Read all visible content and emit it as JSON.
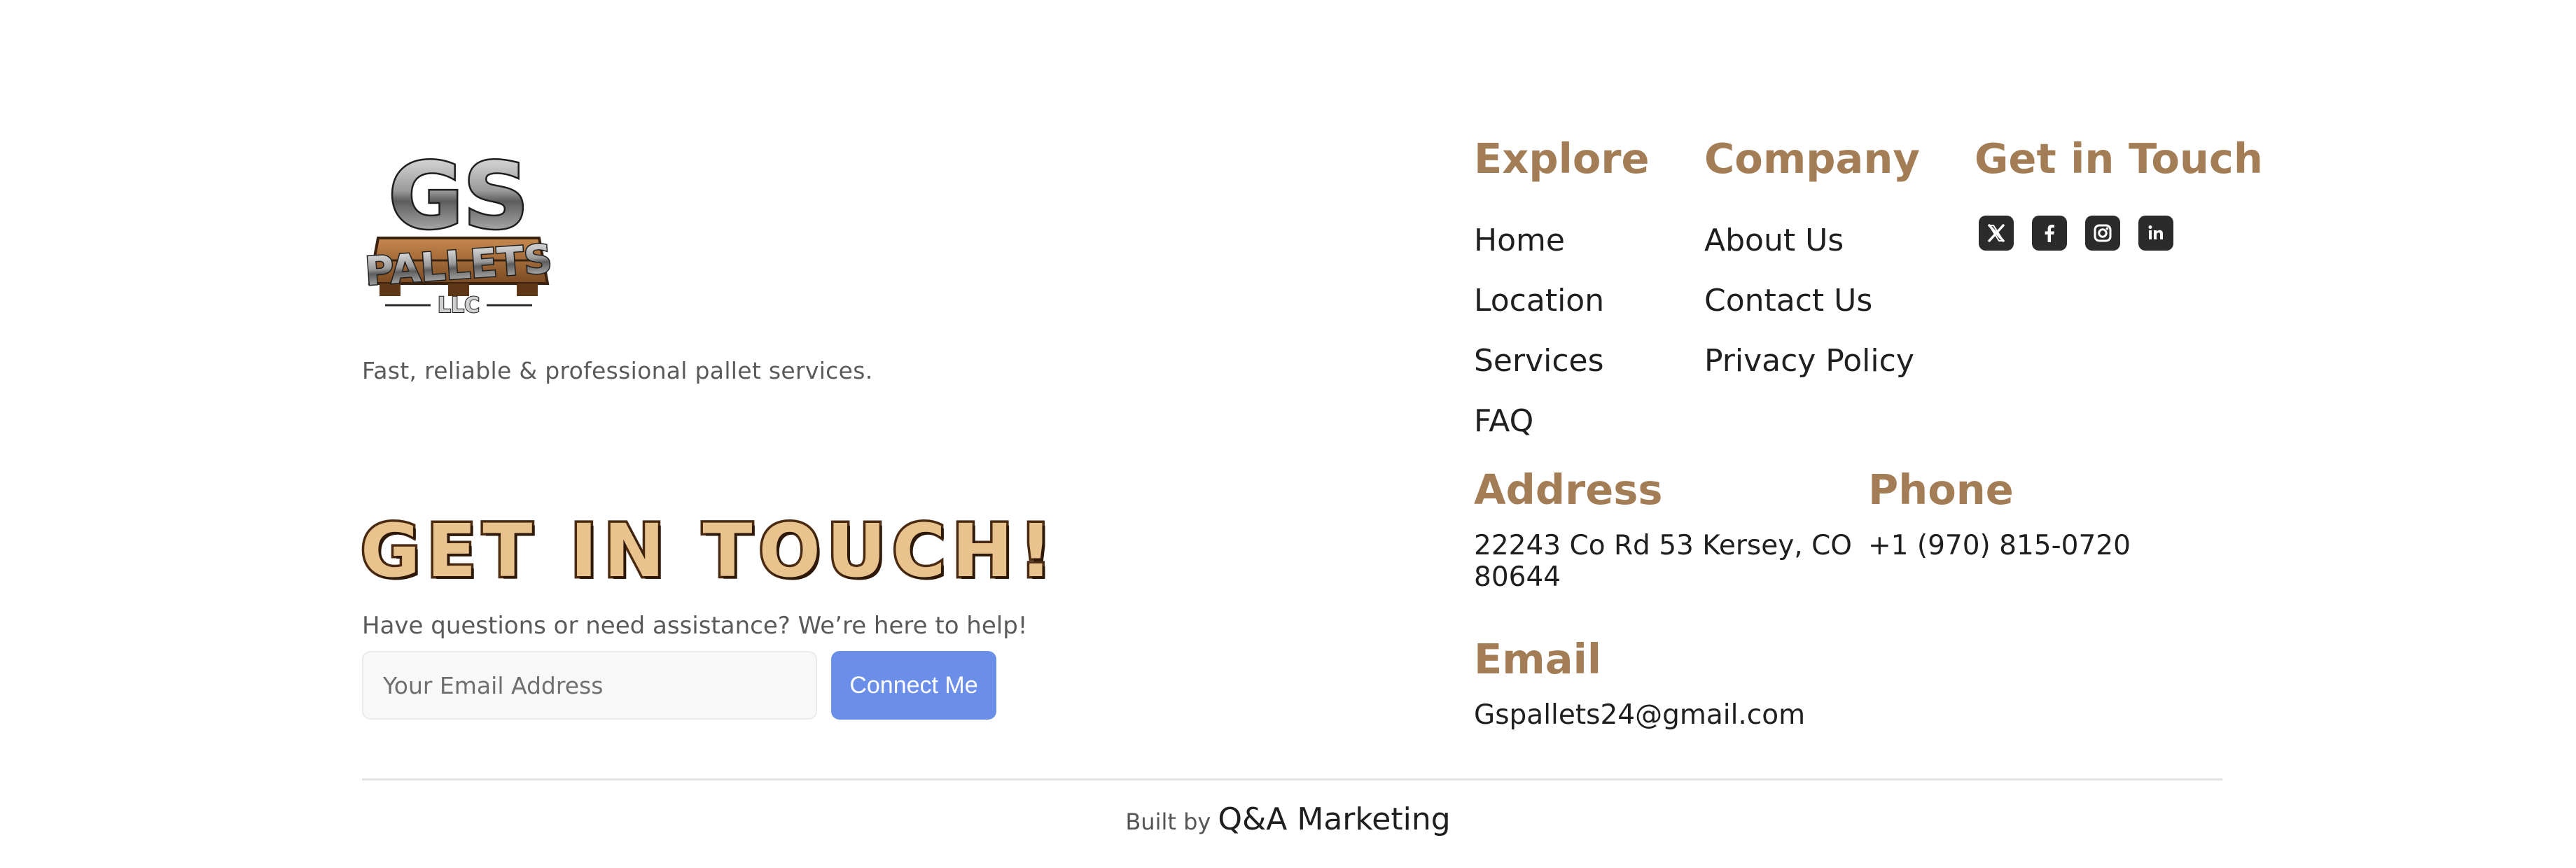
{
  "brand": {
    "logo_text_top": "GS",
    "logo_text_mid": "PALLETS",
    "logo_text_bottom": "LLC",
    "tagline": "Fast, reliable & professional pallet services."
  },
  "contact_form": {
    "title": "GET IN TOUCH!",
    "subtitle": "Have questions or need assistance? We’re here to help!",
    "email_placeholder": "Your Email Address",
    "button_label": "Connect Me"
  },
  "explore": {
    "heading": "Explore",
    "links": [
      "Home",
      "Location",
      "Services",
      "FAQ"
    ]
  },
  "company": {
    "heading": "Company",
    "links": [
      "About Us",
      "Contact Us",
      "Privacy Policy"
    ]
  },
  "social": {
    "heading": "Get in Touch",
    "icons": [
      "x-icon",
      "facebook-icon",
      "instagram-icon",
      "linkedin-icon"
    ]
  },
  "address": {
    "heading": "Address",
    "line1": "22243 Co Rd 53 Kersey, CO",
    "line2": "80644"
  },
  "phone": {
    "heading": "Phone",
    "value": "+1 (970) 815-0720"
  },
  "email": {
    "heading": "Email",
    "value": "Gspallets24@gmail.com"
  },
  "credits": {
    "prefix": "Built by",
    "agency": "Q&A Marketing"
  },
  "colors": {
    "accent": "#a37d55",
    "button": "#6b8fe8",
    "title_fill": "#e8c38e",
    "title_stroke": "#4a2a10"
  }
}
